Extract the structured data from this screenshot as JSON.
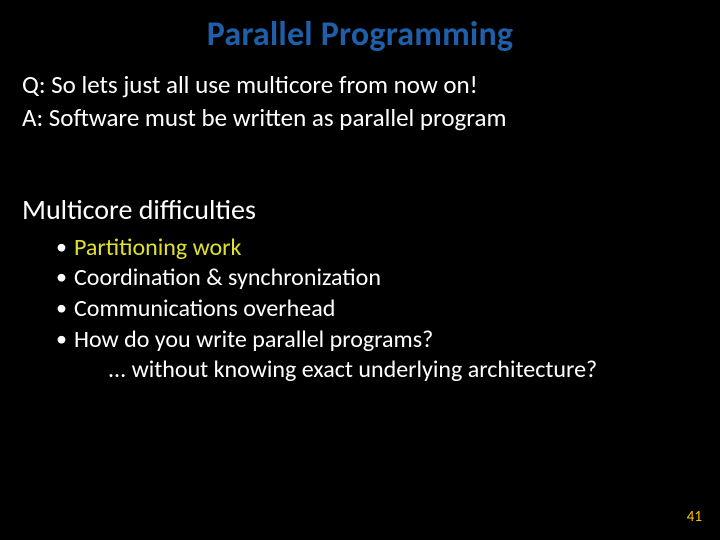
{
  "title": "Parallel Programming",
  "qa": {
    "q": "Q: So lets just all use multicore from now on!",
    "a": "A: Software must be written as parallel program"
  },
  "subhead": "Multicore difficulties",
  "bullets": [
    "Partitioning work",
    "Coordination & synchronization",
    "Communications overhead",
    "How do you write parallel programs?"
  ],
  "continuation": "... without knowing exact underlying architecture?",
  "pagenum": "41"
}
